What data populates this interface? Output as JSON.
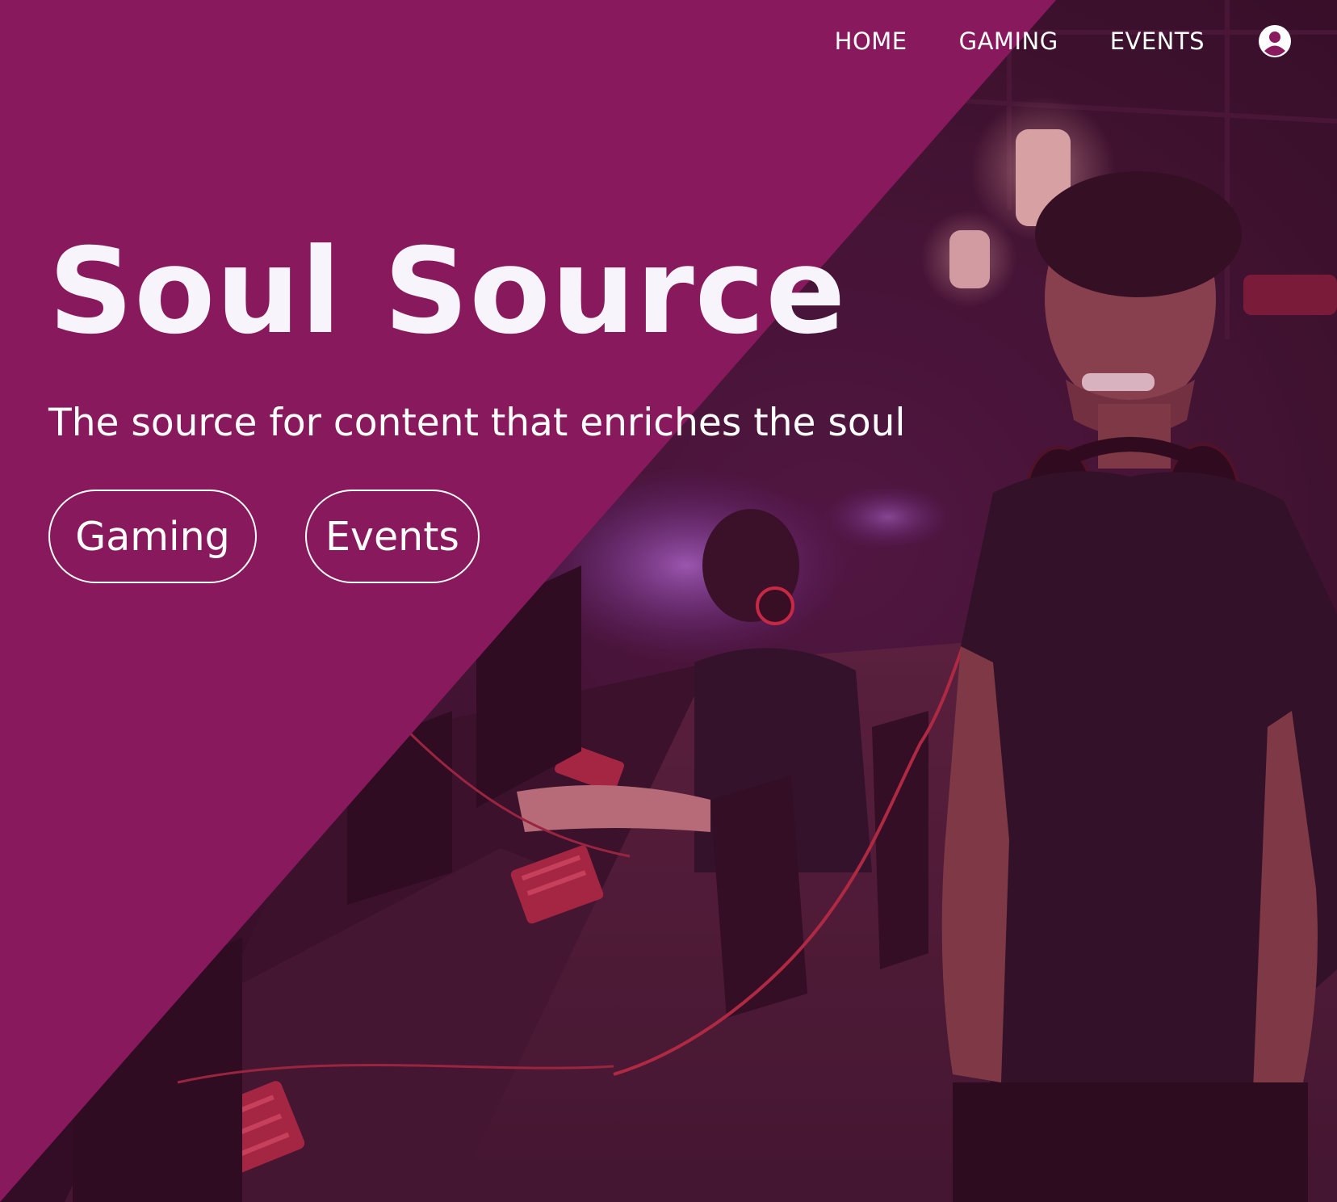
{
  "colors": {
    "brand": "#8a1a5e",
    "text": "#ffffff",
    "photo_tint": "#2a0e22"
  },
  "nav": {
    "items": [
      {
        "label": "HOME"
      },
      {
        "label": "GAMING"
      },
      {
        "label": "EVENTS"
      }
    ],
    "account_icon": "account-circle-icon"
  },
  "hero": {
    "title": "Soul Source",
    "tagline": "The source for content that enriches the soul",
    "buttons": [
      {
        "label": "Gaming"
      },
      {
        "label": "Events"
      }
    ]
  }
}
